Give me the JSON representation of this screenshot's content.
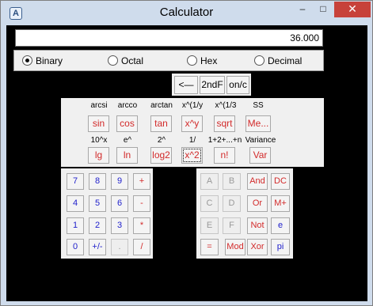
{
  "window": {
    "title": "Calculator",
    "app_icon": "calculator-icon",
    "minimize": "–",
    "maximize": "□",
    "close": "✕"
  },
  "display": {
    "value": "36.000"
  },
  "radix": {
    "selected": "Binary",
    "options": [
      "Binary",
      "Octal",
      "Hex",
      "Decimal"
    ]
  },
  "controls": {
    "back": "<—",
    "second": "2ndF",
    "onc": "on/c"
  },
  "scientific": {
    "labels_row1": [
      "arcsi",
      "arcco",
      "arctan",
      "x^(1/y",
      "x^(1/3",
      "SS"
    ],
    "buttons_row1": [
      "sin",
      "cos",
      "tan",
      "x^y",
      "sqrt",
      "Me..."
    ],
    "labels_row2": [
      "10^x",
      "e^",
      "2^",
      "1/",
      "1+2+...+n",
      "Variance"
    ],
    "buttons_row2": [
      "lg",
      "ln",
      "log2",
      "x^2",
      "n!",
      "Var"
    ]
  },
  "numpad": {
    "rows": [
      [
        "7",
        "8",
        "9",
        "+"
      ],
      [
        "4",
        "5",
        "6",
        "-"
      ],
      [
        "1",
        "2",
        "3",
        "*"
      ],
      [
        "0",
        "+/-",
        ".",
        "/"
      ]
    ]
  },
  "hexpad": {
    "rows": [
      [
        "A",
        "B",
        "And",
        "DC"
      ],
      [
        "C",
        "D",
        "Or",
        "M+"
      ],
      [
        "E",
        "F",
        "Not",
        "e"
      ],
      [
        "=",
        "Mod",
        "Xor",
        "pi"
      ]
    ]
  },
  "colors": {
    "frame": "#cfdcec",
    "client": "#000000",
    "panel": "#f0f0f0",
    "red_text": "#d22a2a",
    "blue_text": "#2222cc",
    "close_button": "#c7423a"
  }
}
